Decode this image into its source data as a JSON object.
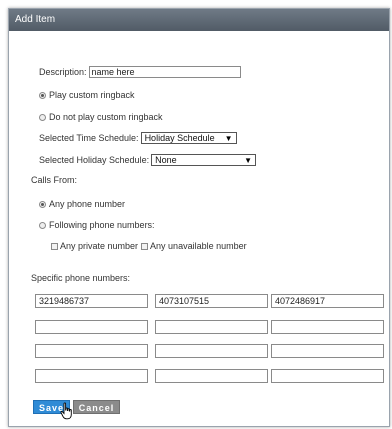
{
  "dialog": {
    "title": "Add Item"
  },
  "form": {
    "description_label": "Description:",
    "description_value": "name here",
    "ringback_options": [
      {
        "label": "Play custom ringback",
        "selected": true
      },
      {
        "label": "Do not play custom ringback",
        "selected": false
      }
    ],
    "time_schedule_label": "Selected Time Schedule:",
    "time_schedule_value": "Holiday Schedule",
    "holiday_schedule_label": "Selected Holiday Schedule:",
    "holiday_schedule_value": "None"
  },
  "calls_from": {
    "label": "Calls From:",
    "options": [
      {
        "label": "Any phone number",
        "selected": true
      },
      {
        "label": "Following phone numbers:",
        "selected": false
      }
    ],
    "checkboxes": [
      {
        "label": "Any private number",
        "checked": false
      },
      {
        "label": "Any unavailable number",
        "checked": false
      }
    ]
  },
  "specific_numbers": {
    "label": "Specific phone numbers:",
    "rows": [
      [
        "3219486737",
        "4073107515",
        "4072486917"
      ],
      [
        "",
        "",
        ""
      ],
      [
        "",
        "",
        ""
      ],
      [
        "",
        "",
        ""
      ]
    ]
  },
  "buttons": {
    "save": "Save",
    "cancel": "Cancel"
  }
}
